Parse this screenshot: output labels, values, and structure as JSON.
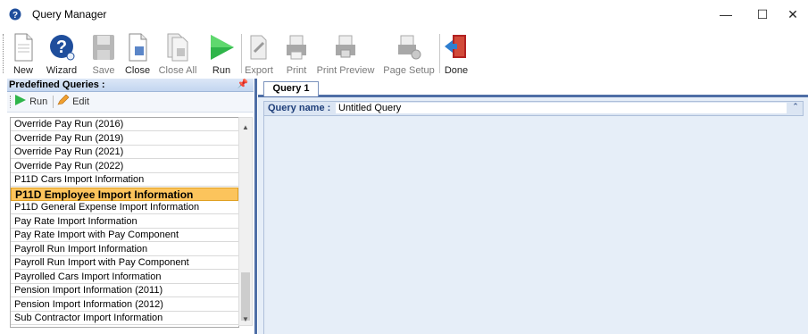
{
  "window": {
    "title": "Query Manager",
    "minimize_icon": "minimize-icon",
    "maximize_icon": "maximize-icon",
    "close_icon": "close-icon"
  },
  "toolbar": {
    "buttons": [
      {
        "label": "New",
        "icon": "new-document-icon",
        "enabled": true
      },
      {
        "label": "Wizard",
        "icon": "wizard-question-icon",
        "enabled": true
      },
      {
        "label": "Save",
        "icon": "save-disk-icon",
        "enabled": false
      },
      {
        "label": "Close",
        "icon": "close-document-icon",
        "enabled": true
      },
      {
        "label": "Close All",
        "icon": "close-all-documents-icon",
        "enabled": false
      },
      {
        "label": "Run",
        "icon": "run-play-icon",
        "enabled": true
      },
      {
        "label": "Export",
        "icon": "export-icon",
        "enabled": false
      },
      {
        "label": "Print",
        "icon": "print-icon",
        "enabled": false
      },
      {
        "label": "Print Preview",
        "icon": "print-preview-icon",
        "enabled": false
      },
      {
        "label": "Page Setup",
        "icon": "page-setup-icon",
        "enabled": false
      },
      {
        "label": "Done",
        "icon": "exit-door-icon",
        "enabled": true
      }
    ]
  },
  "left_pane": {
    "title": "Predefined Queries :",
    "pin_icon": "pin-icon",
    "run_label": "Run",
    "edit_label": "Edit",
    "items": [
      "Override Pay Run (2016)",
      "Override Pay Run (2019)",
      "Override Pay Run (2021)",
      "Override Pay Run (2022)",
      "P11D Cars Import Information",
      "P11D Employee Import Information",
      "P11D General Expense Import Information",
      "Pay Rate Import Information",
      "Pay Rate Import with Pay Component",
      "Payroll Run Import Information",
      "Payroll Run Import with Pay Component",
      "Payrolled Cars Import Information",
      "Pension Import Information (2011)",
      "Pension Import Information (2012)",
      "Sub Contractor Import Information"
    ],
    "selected_index": 5
  },
  "right_pane": {
    "tab_label": "Query 1",
    "query_name_label": "Query name :",
    "query_name_value": "Untitled Query"
  },
  "colors": {
    "selection": "#fcc45c",
    "accent": "#4e6ea6",
    "run_green": "#2fb54a"
  }
}
